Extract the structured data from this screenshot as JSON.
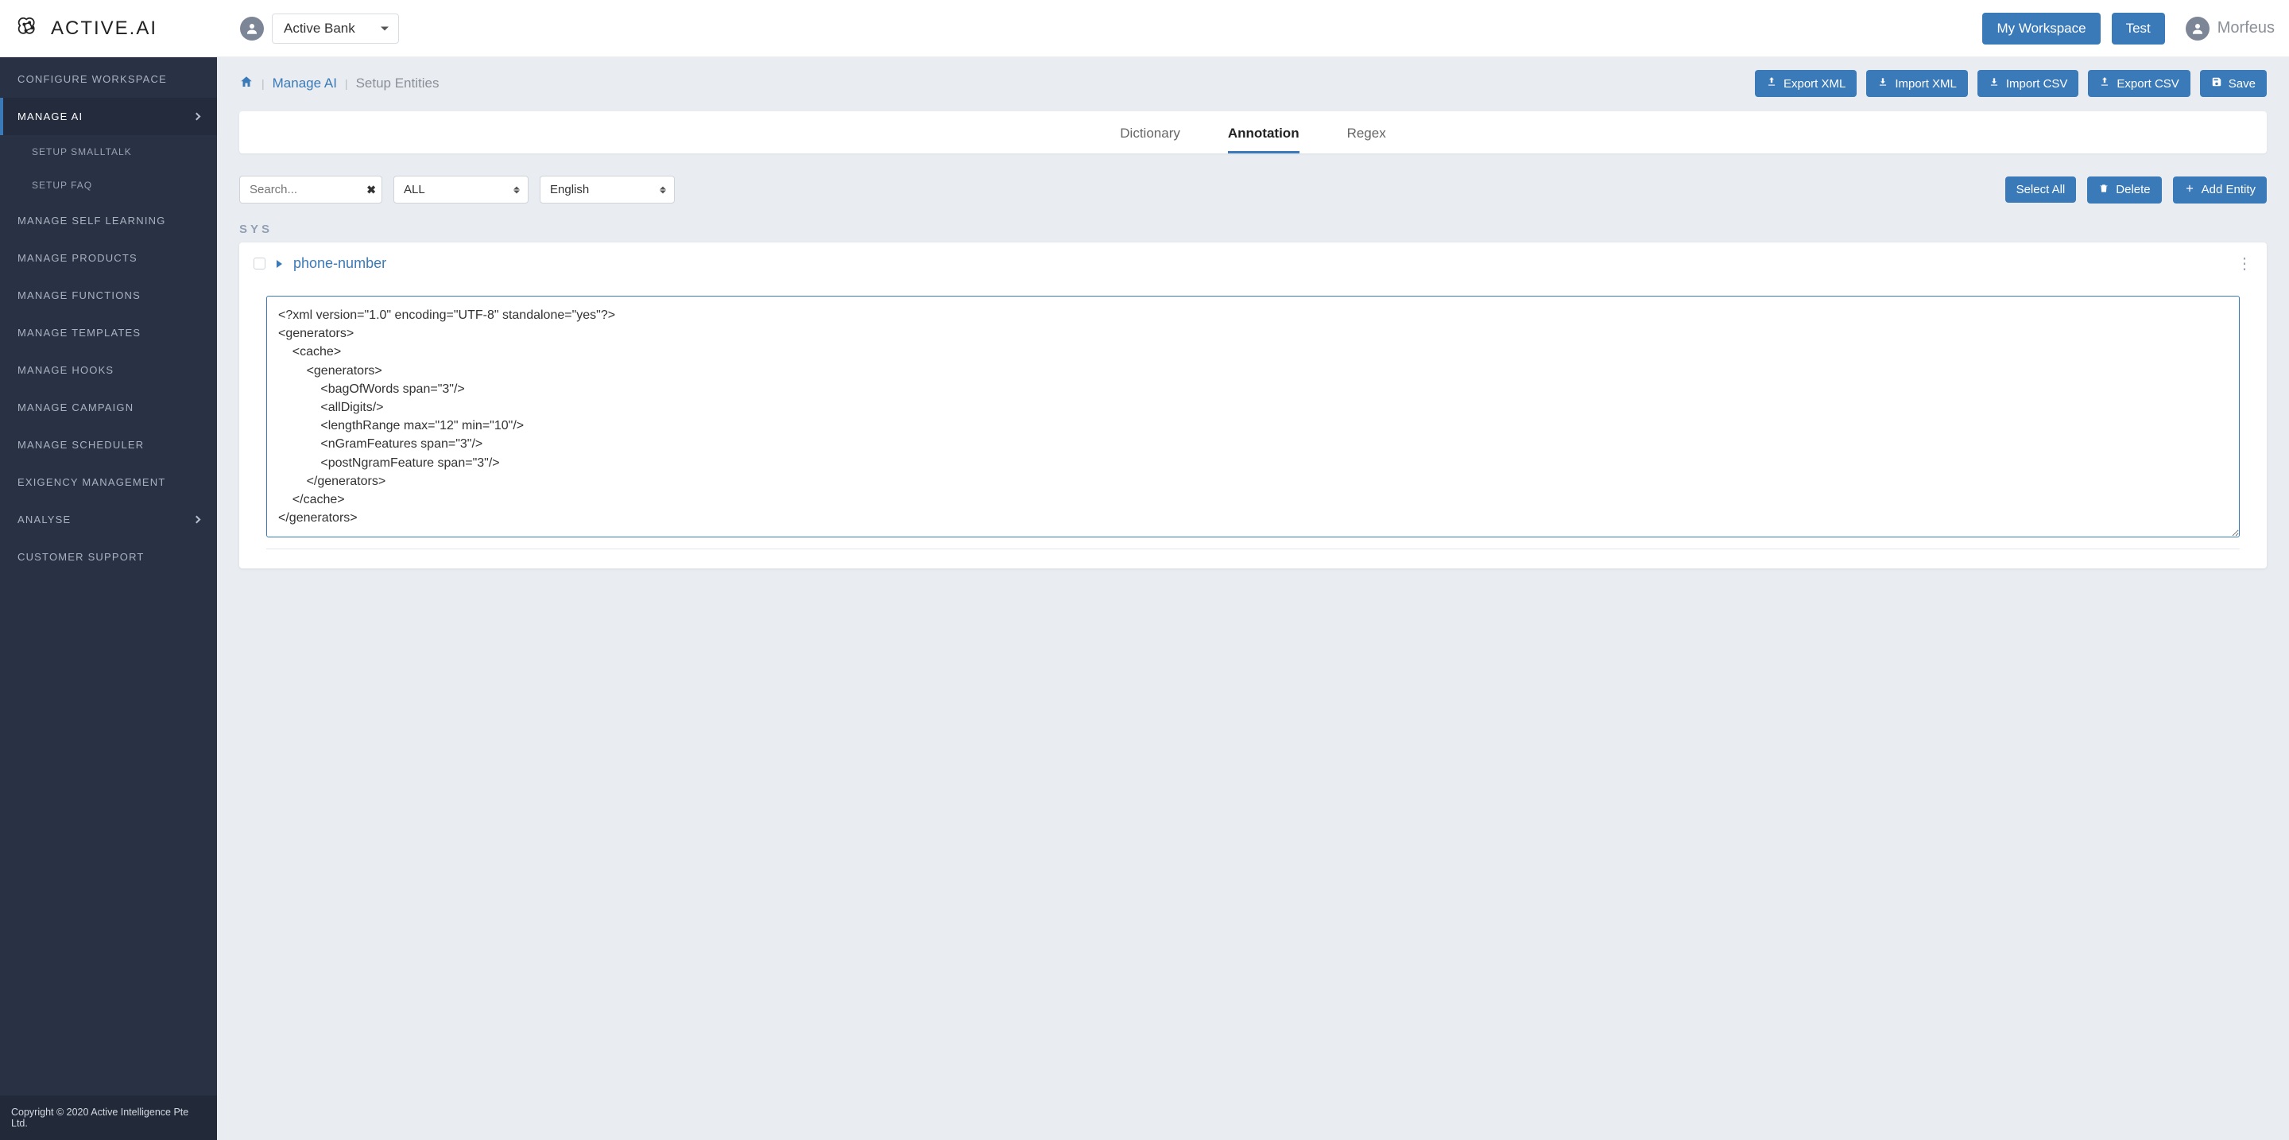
{
  "brand": {
    "name": "ACTIVE.AI"
  },
  "workspace": {
    "selected": "Active Bank"
  },
  "topbar": {
    "my_workspace": "My Workspace",
    "test": "Test",
    "user_name": "Morfeus"
  },
  "sidebar": {
    "items": [
      {
        "label": "CONFIGURE WORKSPACE",
        "has_children": false
      },
      {
        "label": "MANAGE AI",
        "has_children": true,
        "active": true,
        "children": [
          {
            "label": "SETUP SMALLTALK"
          },
          {
            "label": "SETUP FAQ"
          }
        ]
      },
      {
        "label": "MANAGE SELF LEARNING",
        "has_children": false
      },
      {
        "label": "MANAGE PRODUCTS",
        "has_children": false
      },
      {
        "label": "MANAGE FUNCTIONS",
        "has_children": false
      },
      {
        "label": "MANAGE TEMPLATES",
        "has_children": false
      },
      {
        "label": "MANAGE HOOKS",
        "has_children": false
      },
      {
        "label": "MANAGE CAMPAIGN",
        "has_children": false
      },
      {
        "label": "MANAGE SCHEDULER",
        "has_children": false
      },
      {
        "label": "EXIGENCY MANAGEMENT",
        "has_children": false
      },
      {
        "label": "ANALYSE",
        "has_children": true
      },
      {
        "label": "CUSTOMER SUPPORT",
        "has_children": false
      }
    ],
    "footer": "Copyright © 2020 Active Intelligence Pte Ltd."
  },
  "breadcrumb": {
    "link": "Manage AI",
    "current": "Setup Entities"
  },
  "actions": {
    "export_xml": "Export XML",
    "import_xml": "Import XML",
    "import_csv": "Import CSV",
    "export_csv": "Export CSV",
    "save": "Save"
  },
  "tabs": {
    "dictionary": "Dictionary",
    "annotation": "Annotation",
    "regex": "Regex"
  },
  "filters": {
    "search_placeholder": "Search...",
    "select1": "ALL",
    "select2": "English",
    "select_all": "Select All",
    "delete": "Delete",
    "add_entity": "Add Entity"
  },
  "group": {
    "label": "SYS"
  },
  "entity": {
    "name": "phone-number",
    "xml": "<?xml version=\"1.0\" encoding=\"UTF-8\" standalone=\"yes\"?>\n<generators>\n    <cache>\n        <generators>\n            <bagOfWords span=\"3\"/>\n            <allDigits/>\n            <lengthRange max=\"12\" min=\"10\"/>\n            <nGramFeatures span=\"3\"/>\n            <postNgramFeature span=\"3\"/>\n        </generators>\n    </cache>\n</generators>"
  }
}
